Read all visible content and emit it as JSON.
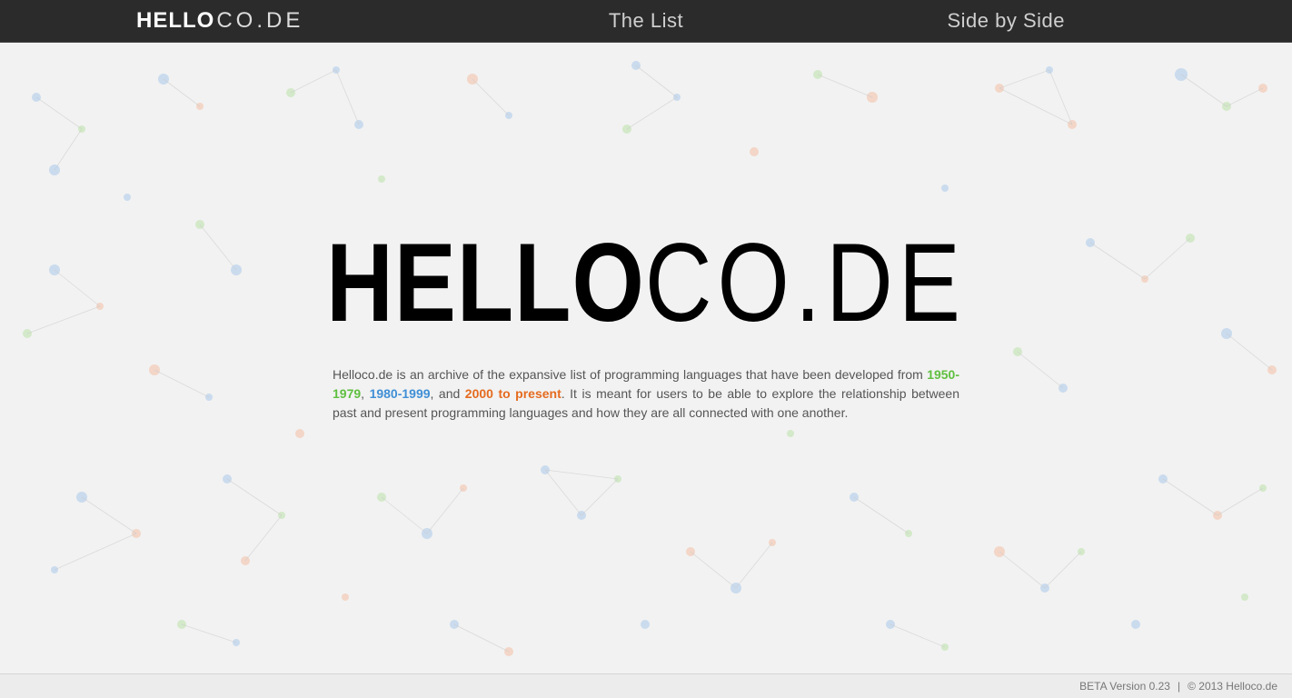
{
  "header": {
    "logo_hello": "HELLO",
    "logo_code": "CO.DE",
    "nav": {
      "list": "The List",
      "side_by_side": "Side by Side"
    }
  },
  "hero": {
    "logo_hello": "HELLO",
    "logo_code": "CO.DE",
    "desc_pre": "Helloco.de is an archive of the expansive list of programming languages that have been developed from ",
    "era1": "1950-1979",
    "sep1": ", ",
    "era2": "1980-1999",
    "sep2": ", and ",
    "era3": "2000 to present",
    "desc_post": ". It is meant for users to be able to explore the relationship between past and present programming languages and how they are all connected with one another.",
    "era_colors": {
      "era1": "#5fbf3f",
      "era2": "#3f8fd6",
      "era3": "#e56b1f"
    }
  },
  "footer": {
    "version": "BETA Version 0.23",
    "separator": "|",
    "copyright": "© 2013 Helloco.de"
  }
}
